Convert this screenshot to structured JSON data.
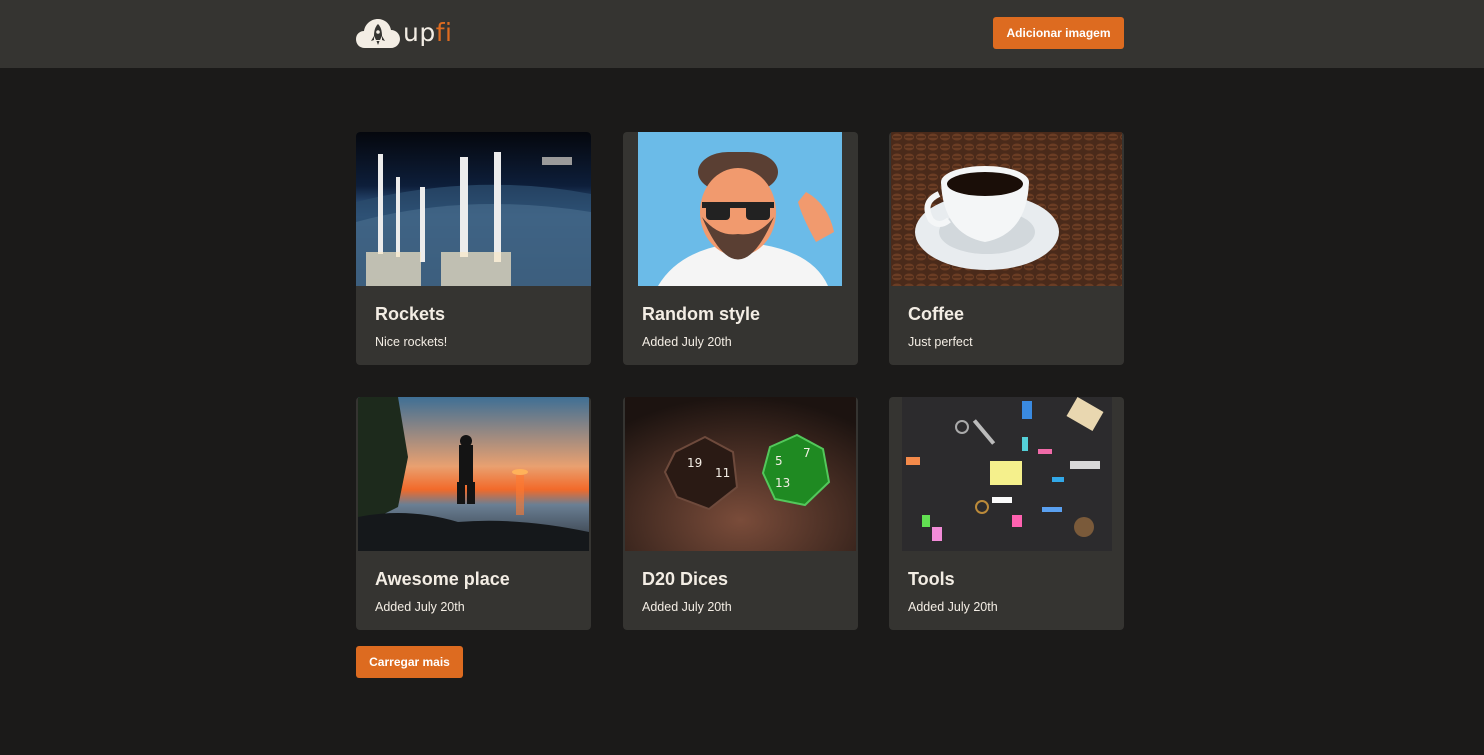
{
  "app": {
    "logo_text_main": "up",
    "logo_text_accent": "fi",
    "accent_color": "#dd6b20",
    "background_color": "#1b1a19",
    "card_color": "#353431"
  },
  "header": {
    "add_image_label": "Adicionar imagem",
    "logo_icon": "cloud-rocket-icon"
  },
  "cards": [
    {
      "title": "Rockets",
      "description": "Nice rockets!"
    },
    {
      "title": "Random style",
      "description": "Added July 20th"
    },
    {
      "title": "Coffee",
      "description": "Just perfect"
    },
    {
      "title": "Awesome place",
      "description": "Added July 20th"
    },
    {
      "title": "D20 Dices",
      "description": "Added July 20th"
    },
    {
      "title": "Tools",
      "description": "Added July 20th"
    }
  ],
  "footer": {
    "load_more_label": "Carregar mais"
  }
}
